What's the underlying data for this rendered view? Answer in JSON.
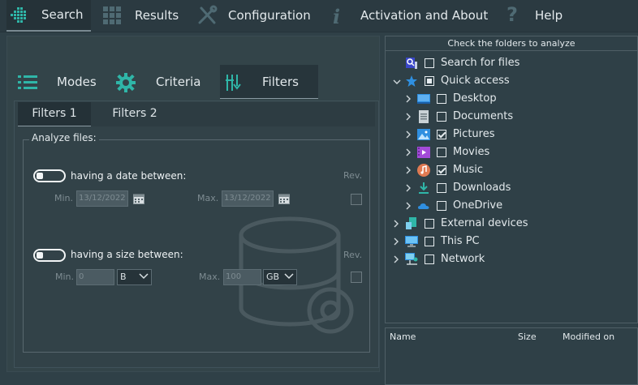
{
  "nav": {
    "items": [
      {
        "label": "Search",
        "icon": "grid-search-icon",
        "active": true
      },
      {
        "label": "Results",
        "icon": "results-grid-icon"
      },
      {
        "label": "Configuration",
        "icon": "wrench-screwdriver-icon"
      },
      {
        "label": "Activation and About",
        "icon": "info-icon"
      },
      {
        "label": "Help",
        "icon": "question-icon"
      }
    ]
  },
  "mode_tabs": [
    {
      "label": "Modes",
      "icon": "list-icon"
    },
    {
      "label": "Criteria",
      "icon": "gear-icon"
    },
    {
      "label": "Filters",
      "icon": "filter-icon",
      "active": true
    }
  ],
  "sub_tabs": [
    {
      "label": "Filters 1",
      "active": true
    },
    {
      "label": "Filters 2"
    }
  ],
  "analyze": {
    "legend": "Analyze files:",
    "date": {
      "label": "having a date between:",
      "min_label": "Min.",
      "min_value": "13/12/2022",
      "max_label": "Max.",
      "max_value": "13/12/2022",
      "rev_label": "Rev."
    },
    "size": {
      "label": "having a size between:",
      "min_label": "Min.",
      "min_value": "0",
      "min_unit": "B",
      "max_label": "Max.",
      "max_value": "100",
      "max_unit": "GB",
      "rev_label": "Rev."
    }
  },
  "folders": {
    "header": "Check the folders to analyze",
    "items": [
      {
        "label": "Search for files",
        "icon": "search-files-icon",
        "state": "unchecked",
        "level": 0,
        "expander": "none"
      },
      {
        "label": "Quick access",
        "icon": "star-icon",
        "state": "partial",
        "level": 0,
        "expander": "expanded"
      },
      {
        "label": "Desktop",
        "icon": "desktop-icon",
        "state": "unchecked",
        "level": 1,
        "expander": "collapsed"
      },
      {
        "label": "Documents",
        "icon": "document-icon",
        "state": "unchecked",
        "level": 1,
        "expander": "collapsed"
      },
      {
        "label": "Pictures",
        "icon": "pictures-icon",
        "state": "checked",
        "level": 1,
        "expander": "collapsed"
      },
      {
        "label": "Movies",
        "icon": "movies-icon",
        "state": "unchecked",
        "level": 1,
        "expander": "collapsed"
      },
      {
        "label": "Music",
        "icon": "music-icon",
        "state": "checked",
        "level": 1,
        "expander": "collapsed"
      },
      {
        "label": "Downloads",
        "icon": "download-icon",
        "state": "unchecked",
        "level": 1,
        "expander": "collapsed"
      },
      {
        "label": "OneDrive",
        "icon": "cloud-icon",
        "state": "unchecked",
        "level": 1,
        "expander": "collapsed"
      },
      {
        "label": "External devices",
        "icon": "external-devices-icon",
        "state": "unchecked",
        "level": 0,
        "expander": "collapsed"
      },
      {
        "label": "This PC",
        "icon": "pc-icon",
        "state": "unchecked",
        "level": 0,
        "expander": "collapsed"
      },
      {
        "label": "Network",
        "icon": "network-icon",
        "state": "unchecked",
        "level": 0,
        "expander": "collapsed"
      }
    ]
  },
  "file_list": {
    "columns": [
      "Name",
      "Size",
      "Modified on"
    ]
  },
  "colors": {
    "background": "#2f4047",
    "accent_teal": "#2fb6a8",
    "accent_blue": "#2f8fe0"
  }
}
